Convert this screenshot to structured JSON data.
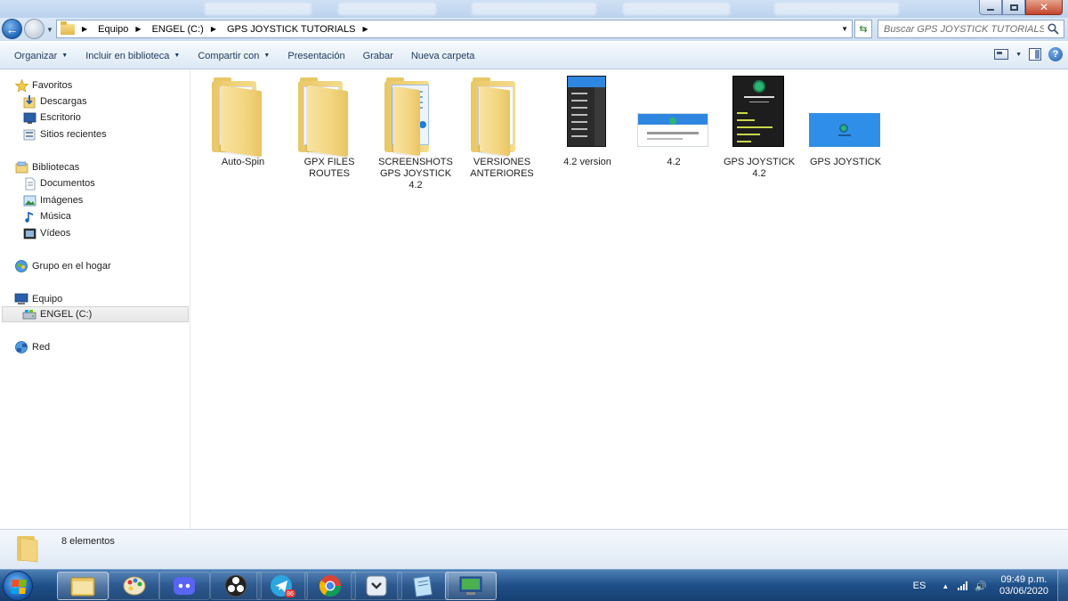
{
  "window": {
    "minimize_icon": "minimize-icon",
    "maximize_icon": "maximize-icon",
    "close_icon": "close-icon"
  },
  "address_bar": {
    "breadcrumbs": [
      "Equipo",
      "ENGEL (C:)",
      "GPS JOYSTICK TUTORIALS"
    ],
    "search_placeholder": "Buscar GPS JOYSTICK TUTORIALS"
  },
  "toolbar": {
    "organize": "Organizar",
    "include_library": "Incluir en biblioteca",
    "share_with": "Compartir con",
    "slideshow": "Presentación",
    "burn": "Grabar",
    "new_folder": "Nueva carpeta"
  },
  "nav": {
    "favorites": "Favoritos",
    "downloads": "Descargas",
    "desktop": "Escritorio",
    "recent": "Sitios recientes",
    "libraries": "Bibliotecas",
    "documents": "Documentos",
    "images": "Imágenes",
    "music": "Música",
    "videos": "Vídeos",
    "homegroup": "Grupo en el hogar",
    "computer": "Equipo",
    "drive": "ENGEL (C:)",
    "network": "Red"
  },
  "files": [
    {
      "name": "Auto-Spin",
      "type": "folder"
    },
    {
      "name": "GPX FILES ROUTES",
      "type": "folder"
    },
    {
      "name": "SCREENSHOTS GPS JOYSTICK 4.2",
      "type": "folder"
    },
    {
      "name": "VERSIONES ANTERIORES",
      "type": "folder"
    },
    {
      "name": "4.2 version",
      "type": "image"
    },
    {
      "name": "4.2",
      "type": "image"
    },
    {
      "name": "GPS JOYSTICK 4.2",
      "type": "image"
    },
    {
      "name": "GPS JOYSTICK",
      "type": "image"
    }
  ],
  "status": {
    "count_text": "8 elementos"
  },
  "taskbar": {
    "apps": [
      "file-explorer",
      "paint",
      "discord",
      "obs",
      "telegram",
      "chrome",
      "app-down",
      "notepad",
      "remote-desktop"
    ],
    "telegram_badge": "86",
    "language": "ES",
    "time": "09:49 p.m.",
    "date": "03/06/2020"
  },
  "colors": {
    "accent": "#1f63b5",
    "folder": "#f3d57f",
    "taskbar": "#1f4f88"
  }
}
